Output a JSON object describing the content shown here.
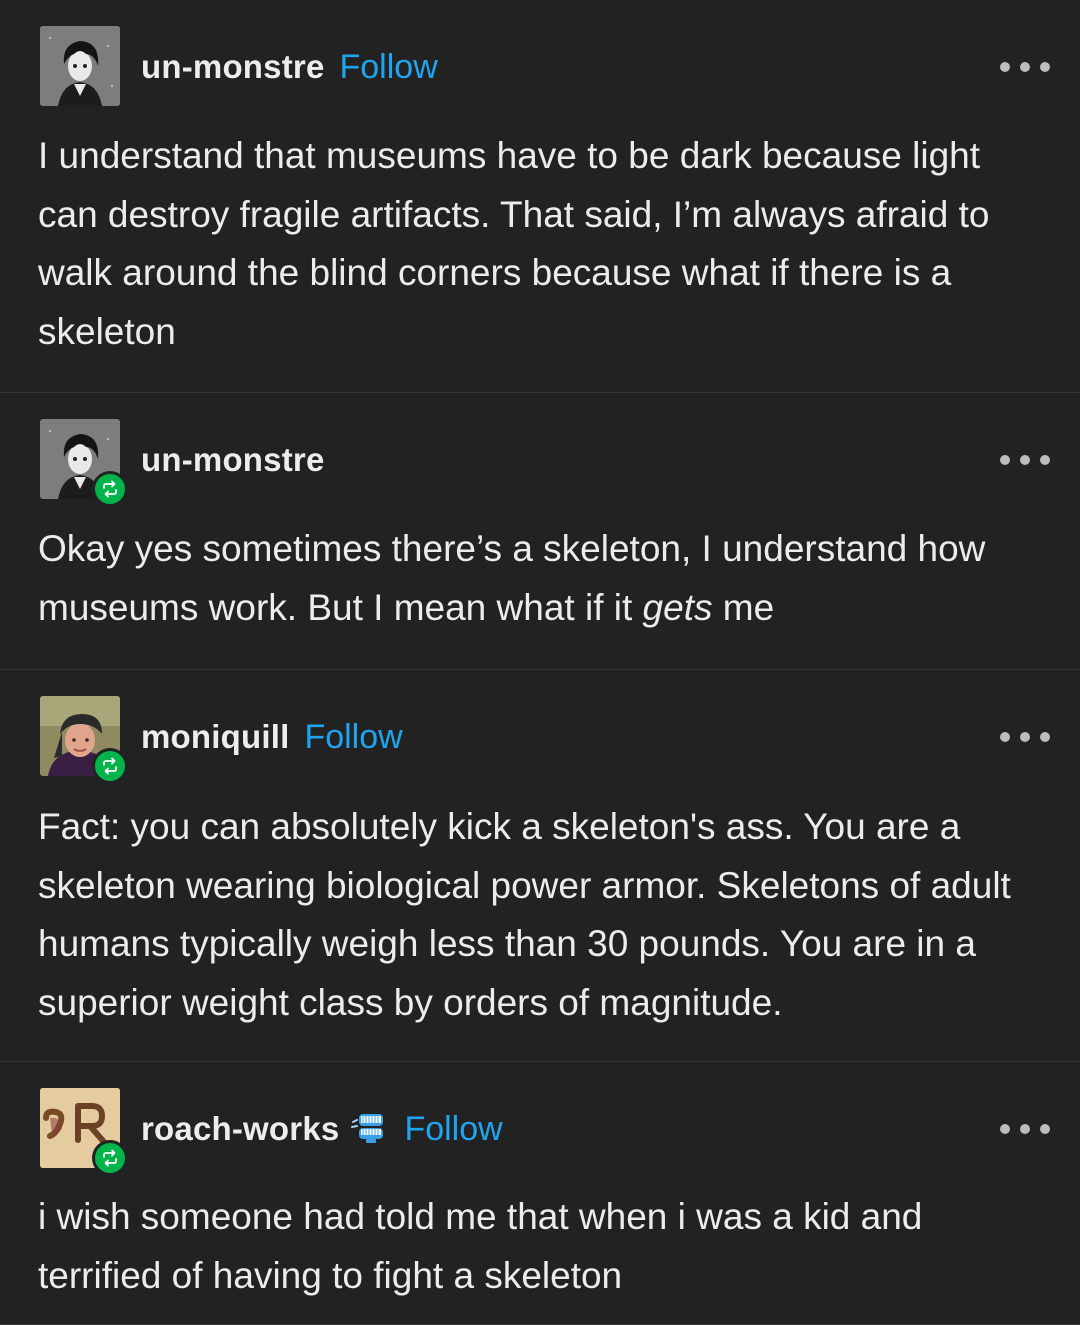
{
  "posts": [
    {
      "username": "un-monstre",
      "follow_label": "Follow",
      "reblogged": false,
      "avatar": "gothic-boy-avatar",
      "text": "I understand that museums have to be dark because light can destroy fragile artifacts. That said, I’m always afraid to walk around the blind corners because what if there is a skeleton"
    },
    {
      "username": "un-monstre",
      "reblogged": true,
      "avatar": "gothic-boy-avatar",
      "text_before": "Okay yes sometimes there’s a skeleton, I understand how museums work. But I mean what if it ",
      "text_emphasis": "gets",
      "text_after": " me"
    },
    {
      "username": "moniquill",
      "follow_label": "Follow",
      "reblogged": true,
      "avatar": "woman-headscarf-avatar",
      "text": "Fact: you can absolutely kick a skeleton's ass. You are a skeleton wearing biological power armor. Skeletons of adult humans typically weigh less than 30 pounds. You are in a superior weight class by orders of magnitude."
    },
    {
      "username": "roach-works",
      "follow_label": "Follow",
      "reblogged": true,
      "avatar": "rw-monogram-avatar",
      "badge_icon": "chattering-teeth-icon",
      "text": "i wish someone had told me that when i was a kid and terrified of having to fight a skeleton"
    }
  ],
  "colors": {
    "background": "#222222",
    "text": "#ececec",
    "follow": "#1fa5f0",
    "reblog_badge": "#00b34a",
    "divider": "#363636"
  }
}
